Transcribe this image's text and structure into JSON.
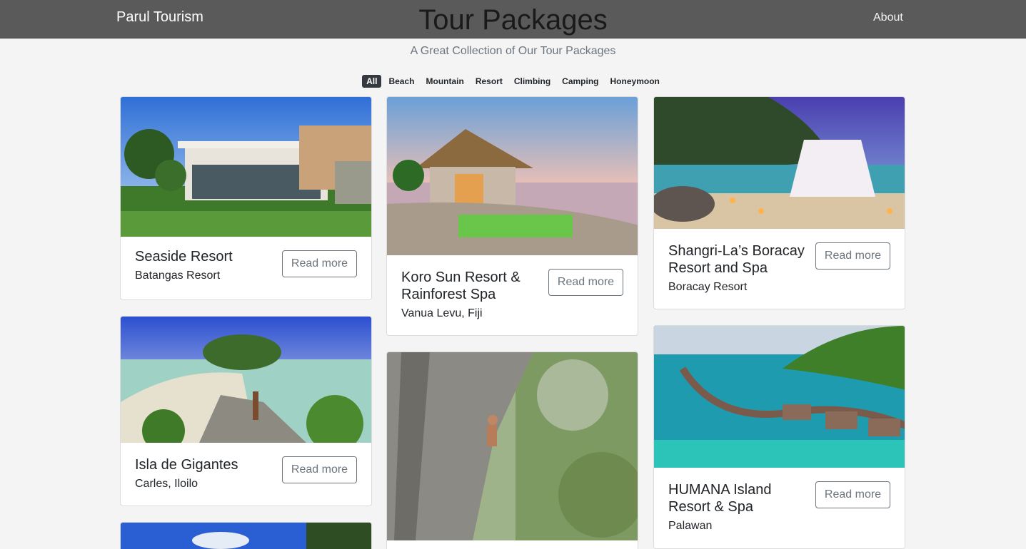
{
  "nav": {
    "brand": "Parul Tourism",
    "title": "Tour Packages",
    "about": "About"
  },
  "subtitle": "A Great Collection of Our Tour Packages",
  "filters": [
    "All",
    "Beach",
    "Mountain",
    "Resort",
    "Climbing",
    "Camping",
    "Honeymoon"
  ],
  "cards": [
    {
      "title": "Seaside Resort",
      "location": "Batangas Resort",
      "button": "Read more"
    },
    {
      "title": "Isla de Gigantes",
      "location": "Carles, Iloilo",
      "button": "Read more"
    },
    {
      "title": "Koro Sun Resort & Rainforest Spa",
      "location": "Vanua Levu, Fiji",
      "button": "Read more"
    },
    {
      "title": "Shangri-La’s Boracay Resort and Spa",
      "location": "Boracay Resort",
      "button": "Read more"
    },
    {
      "title": "HUMANA Island Resort & Spa",
      "location": "Palawan",
      "button": "Read more"
    }
  ]
}
